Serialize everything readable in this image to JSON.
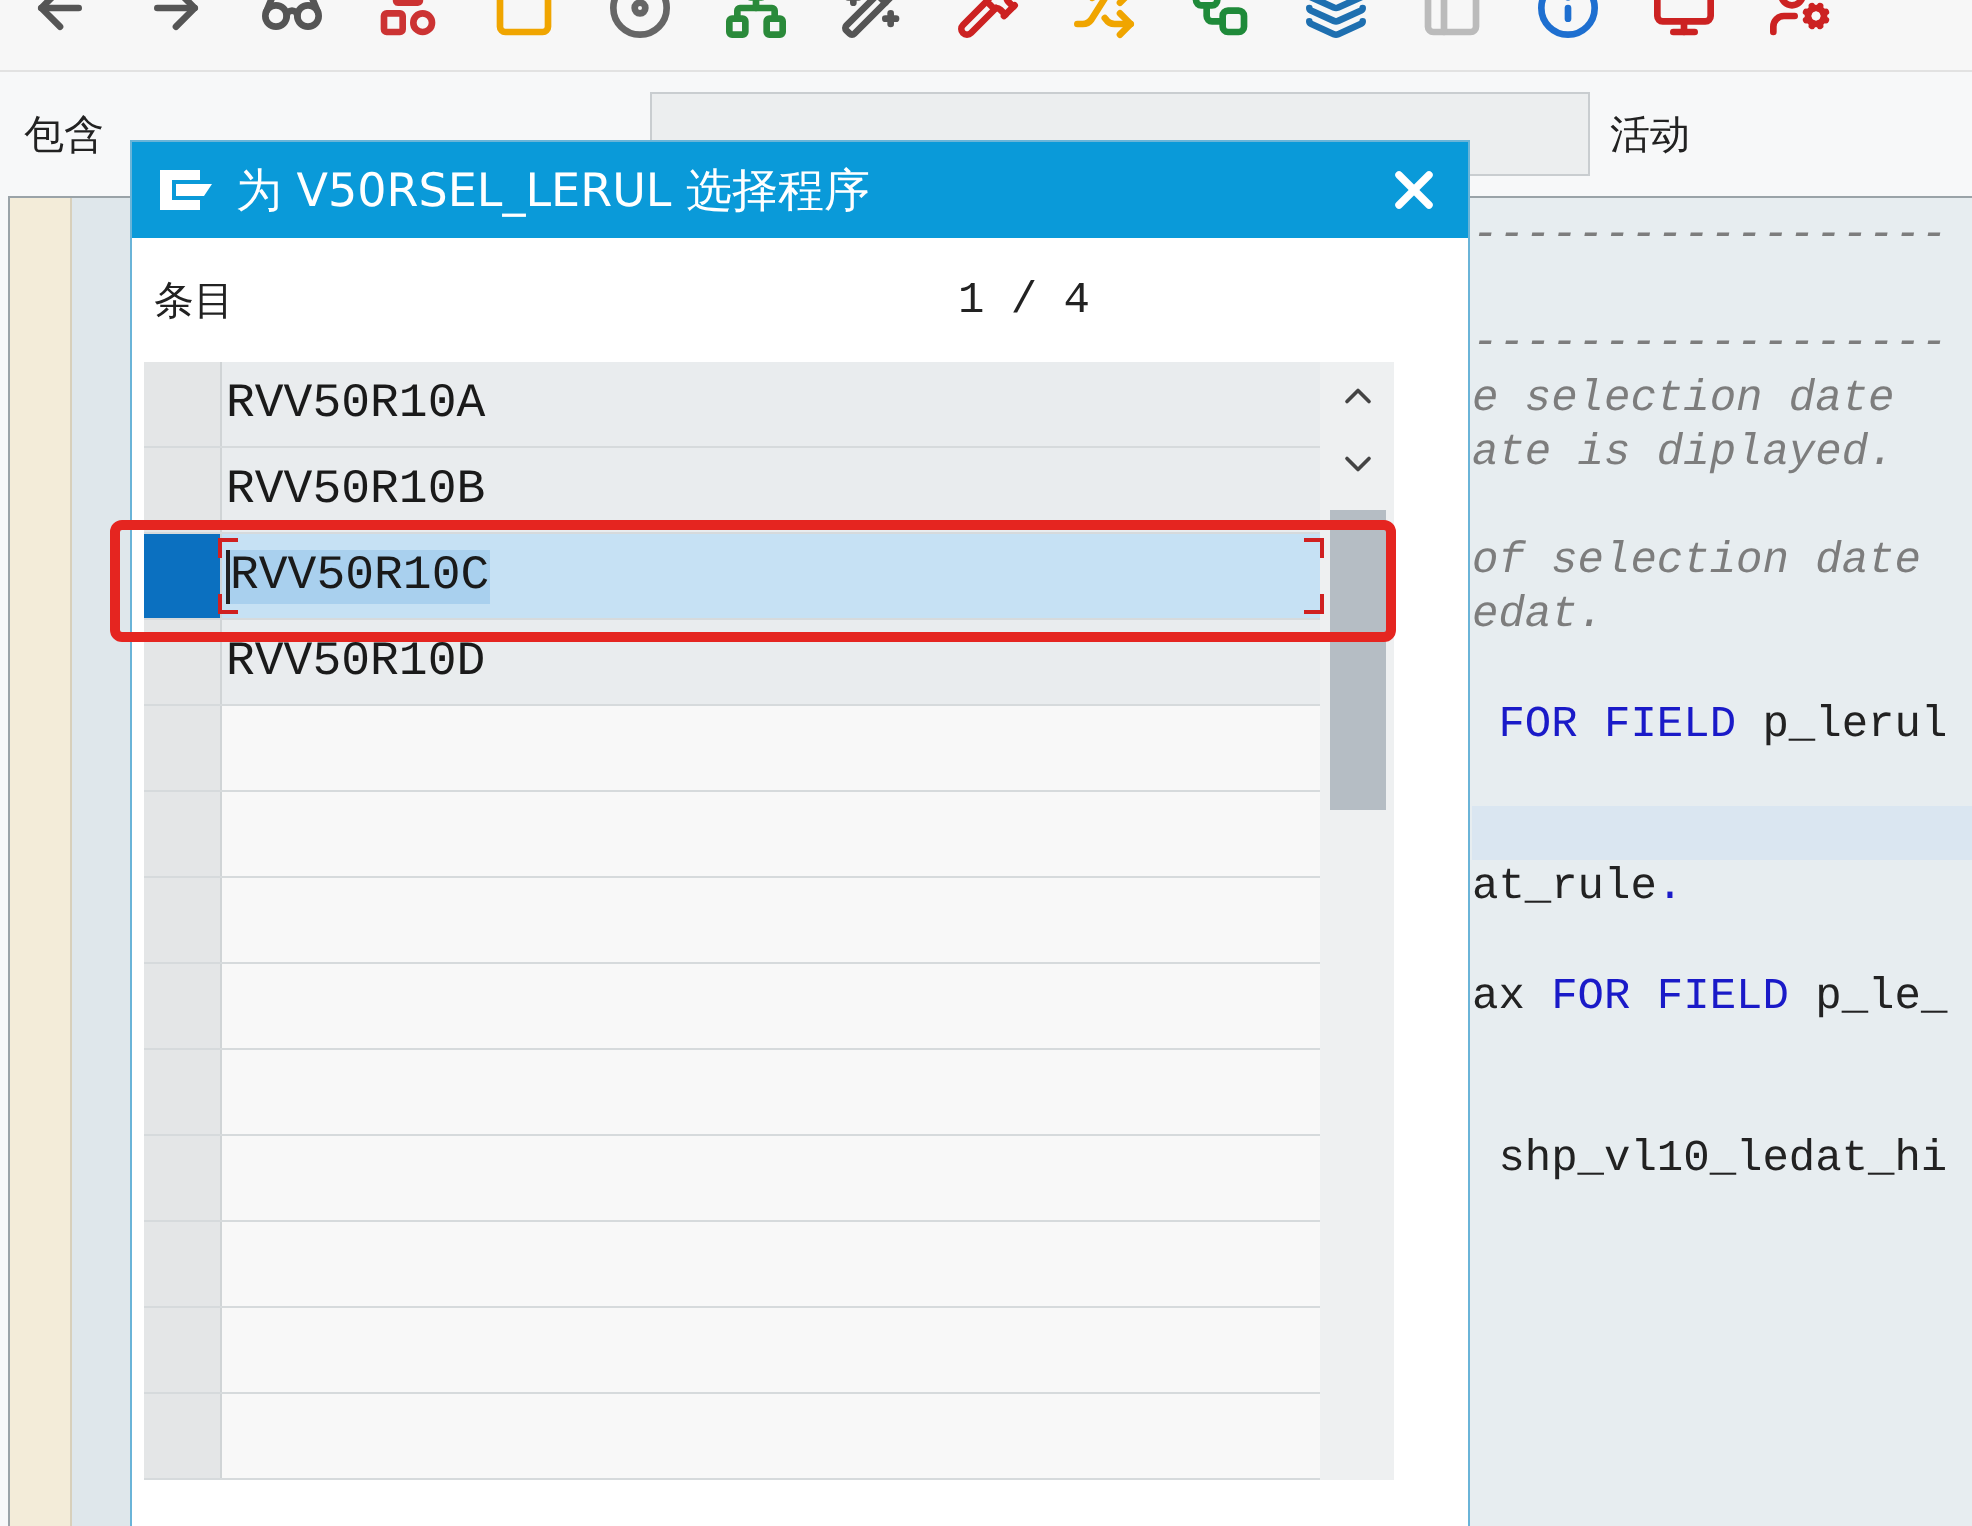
{
  "header": {
    "label": "包含",
    "status": "活动"
  },
  "editor": {
    "lines": [
      {
        "segments": [
          {
            "kind": "comment",
            "text": "------------------"
          }
        ]
      },
      {
        "kind": "blank"
      },
      {
        "segments": [
          {
            "kind": "comment",
            "text": "------------------"
          }
        ]
      },
      {
        "segments": [
          {
            "kind": "comment",
            "text": "e selection date"
          }
        ]
      },
      {
        "segments": [
          {
            "kind": "comment",
            "text": "ate is diplayed."
          }
        ]
      },
      {
        "kind": "blank"
      },
      {
        "segments": [
          {
            "kind": "comment",
            "text": "of selection date"
          }
        ]
      },
      {
        "segments": [
          {
            "kind": "comment",
            "text": "edat."
          }
        ]
      },
      {
        "kind": "blank"
      },
      {
        "segments": [
          {
            "kind": "keyword",
            "text": " FOR FIELD"
          },
          {
            "kind": "plain",
            "text": " p_lerul"
          }
        ]
      },
      {
        "kind": "blank"
      },
      {
        "current": true
      },
      {
        "segments": [
          {
            "kind": "plain",
            "text": "at_rule"
          },
          {
            "kind": "keyword",
            "text": "."
          }
        ]
      },
      {
        "kind": "blank"
      },
      {
        "segments": [
          {
            "kind": "plain",
            "text": "ax "
          },
          {
            "kind": "keyword",
            "text": "FOR FIELD"
          },
          {
            "kind": "plain",
            "text": " p_le_"
          }
        ]
      },
      {
        "kind": "blank"
      },
      {
        "kind": "blank"
      },
      {
        "segments": [
          {
            "kind": "plain",
            "text": " shp_vl10_ledat_hi"
          }
        ]
      }
    ]
  },
  "dialog": {
    "title": "为 V50RSEL_LERUL 选择程序",
    "entries_label": "条目",
    "counter": "1 / 4",
    "rows": [
      {
        "text": "RVV50R10A",
        "selected": false
      },
      {
        "text": "RVV50R10B",
        "selected": false
      },
      {
        "text": "RVV50R10C",
        "selected": true
      },
      {
        "text": "RVV50R10D",
        "selected": false
      }
    ]
  }
}
